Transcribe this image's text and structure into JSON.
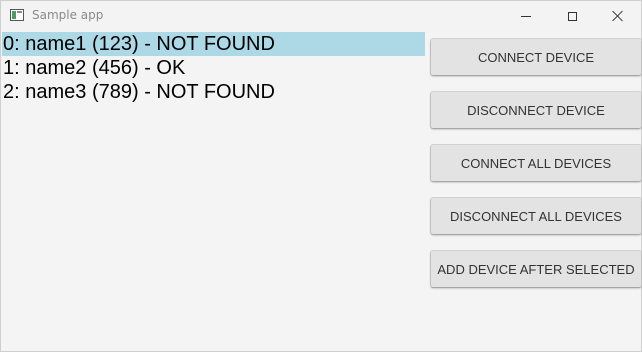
{
  "window": {
    "title": "Sample app"
  },
  "devices": [
    {
      "text": "0: name1 (123) - NOT FOUND",
      "selected": true
    },
    {
      "text": "1: name2 (456) - OK",
      "selected": false
    },
    {
      "text": "2: name3 (789) - NOT FOUND",
      "selected": false
    }
  ],
  "buttons": {
    "connect": "CONNECT DEVICE",
    "disconnect": "DISCONNECT DEVICE",
    "connect_all": "CONNECT ALL DEVICES",
    "disconnect_all": "DISCONNECT ALL DEVICES",
    "add_after": "ADD DEVICE AFTER SELECTED"
  },
  "colors": {
    "selection": "#add8e6",
    "button_bg": "#e3e3e3",
    "window_bg": "#f4f4f4"
  },
  "icons": {
    "app": "app-window-icon",
    "minimize": "minimize-icon",
    "maximize": "maximize-icon",
    "close": "close-icon"
  }
}
